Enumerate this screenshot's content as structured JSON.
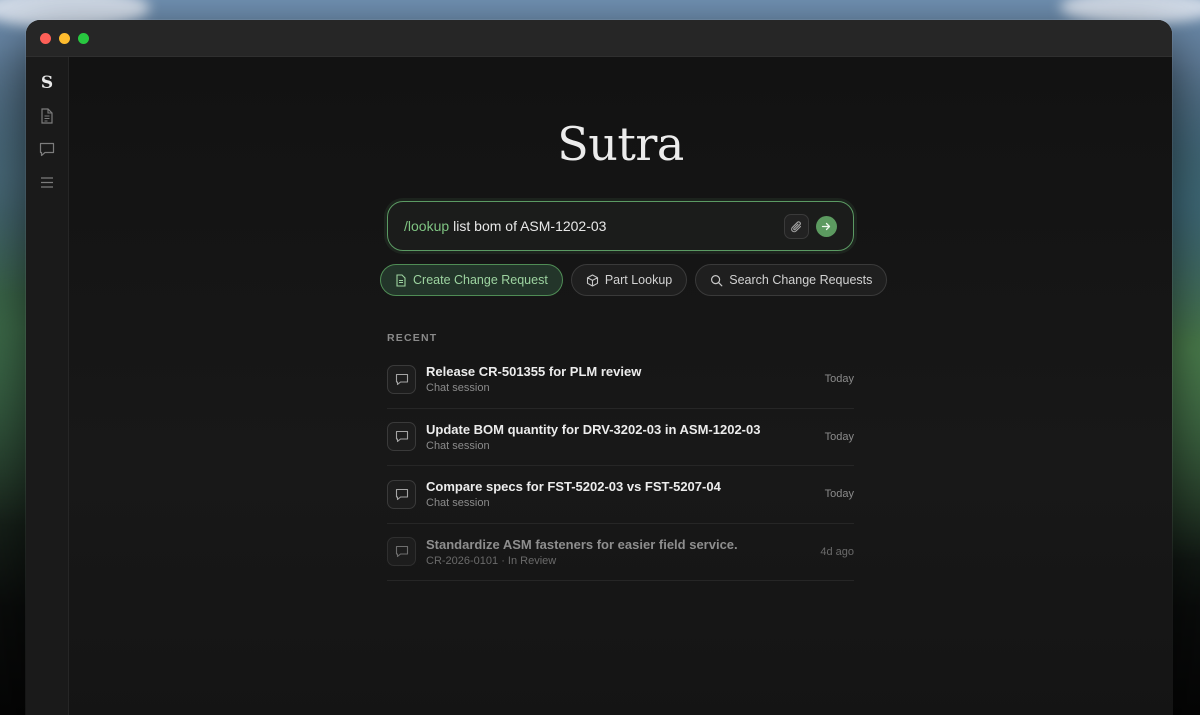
{
  "window": {
    "traffic_lights": [
      "#fe5f57",
      "#febc2e",
      "#28c840"
    ]
  },
  "sidebar": {
    "brand": "S",
    "icons": [
      "document-icon",
      "chat-icon",
      "list-icon"
    ]
  },
  "logo": "Sutra",
  "prompt": {
    "command": "/lookup",
    "text": "list bom of ASM-1202-03",
    "accent": "#5c9a60"
  },
  "quick_actions": [
    {
      "label": "Create Change Request",
      "icon": "document-icon",
      "active": true
    },
    {
      "label": "Part Lookup",
      "icon": "cube-icon",
      "active": false
    },
    {
      "label": "Search Change Requests",
      "icon": "search-icon",
      "active": false
    }
  ],
  "recent": {
    "label": "RECENT",
    "items": [
      {
        "title": "Release CR-501355 for PLM review",
        "subtitle": "Chat session",
        "time": "Today"
      },
      {
        "title": "Update BOM quantity for DRV-3202-03 in ASM-1202-03",
        "subtitle": "Chat session",
        "time": "Today"
      },
      {
        "title": "Compare specs for FST-5202-03 vs FST-5207-04",
        "subtitle": "Chat session",
        "time": "Today"
      },
      {
        "title": "Standardize ASM fasteners for easier field service.",
        "subtitle": "CR-2026-0101 · In Review",
        "time": "4d ago"
      }
    ]
  }
}
